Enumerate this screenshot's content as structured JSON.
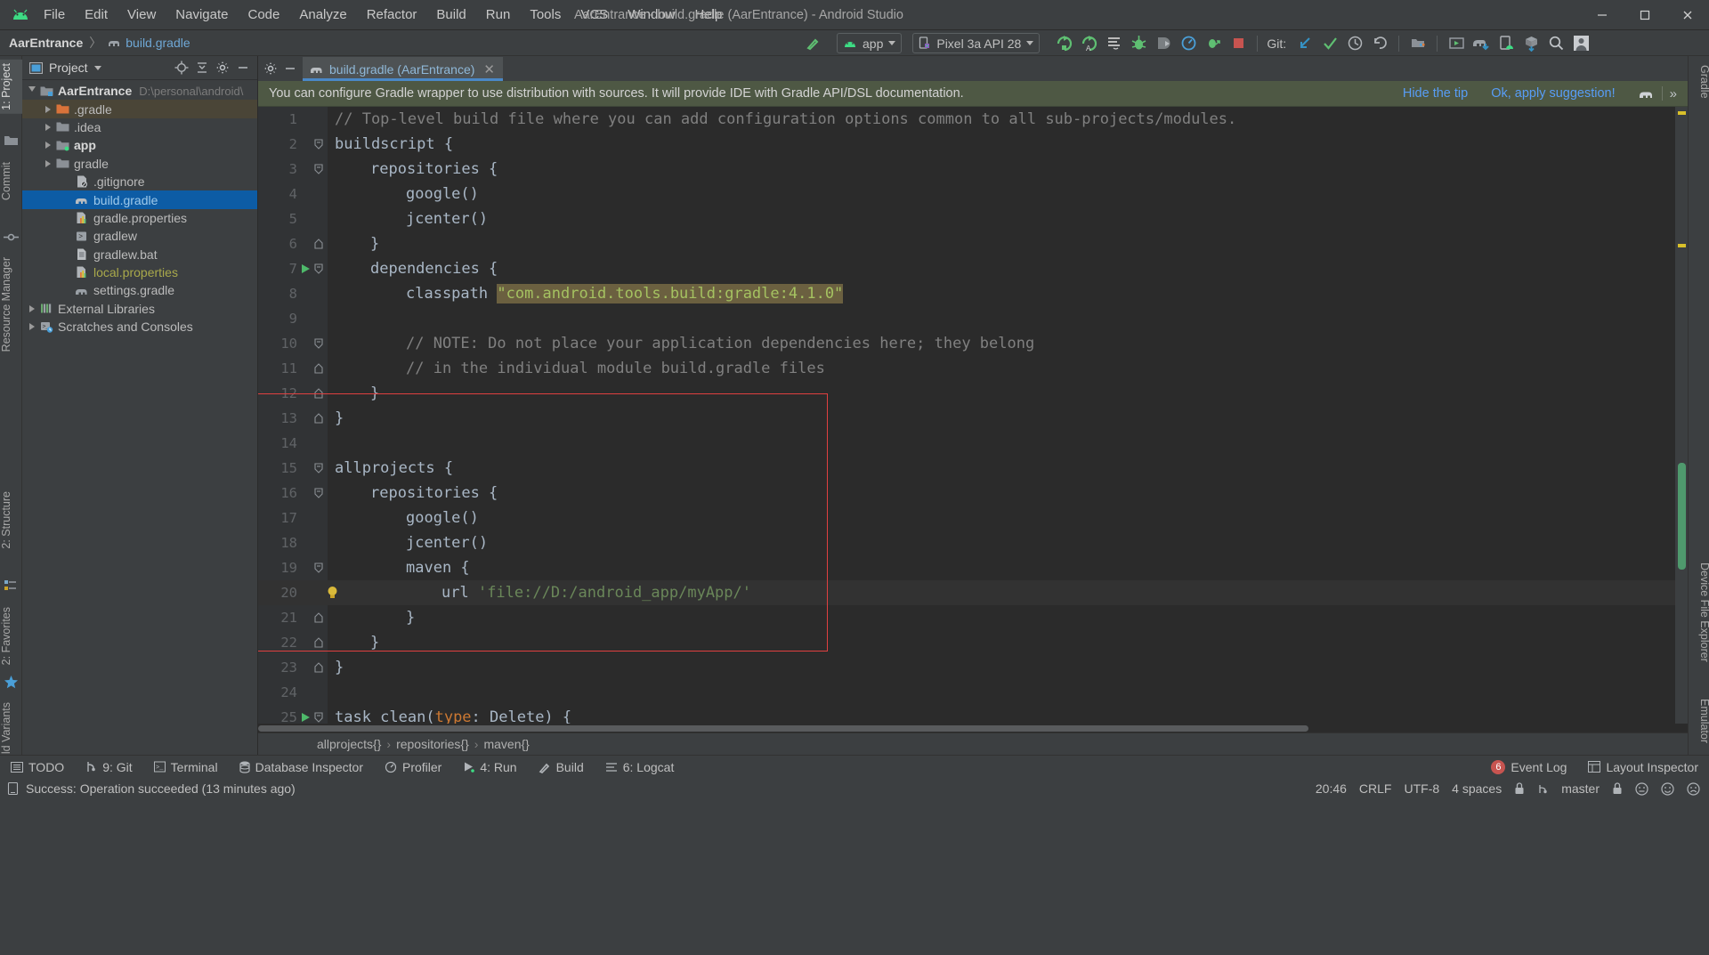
{
  "window": {
    "title": "AarEntrance - build.gradle (AarEntrance) - Android Studio",
    "minimize_label": "–",
    "maximize_label": "❐",
    "close_label": "✕"
  },
  "menu": [
    {
      "label": "File",
      "mnemonic": "F"
    },
    {
      "label": "Edit",
      "mnemonic": "E"
    },
    {
      "label": "View",
      "mnemonic": "V"
    },
    {
      "label": "Navigate",
      "mnemonic": "N"
    },
    {
      "label": "Code",
      "mnemonic": "C"
    },
    {
      "label": "Analyze",
      "mnemonic": "z"
    },
    {
      "label": "Refactor",
      "mnemonic": "R"
    },
    {
      "label": "Build",
      "mnemonic": "B"
    },
    {
      "label": "Run",
      "mnemonic": "u"
    },
    {
      "label": "Tools",
      "mnemonic": "T"
    },
    {
      "label": "VCS",
      "mnemonic": "S"
    },
    {
      "label": "Window",
      "mnemonic": "W"
    },
    {
      "label": "Help",
      "mnemonic": "H"
    }
  ],
  "navbar": {
    "project_crumb": "AarEntrance",
    "separator": "〉",
    "file_crumb": "build.gradle",
    "run_config": "app",
    "device": "Pixel 3a API 28",
    "git_label": "Git:"
  },
  "toolbar_icons": [
    {
      "name": "build-hammer-icon"
    },
    {
      "name": "run-icon"
    },
    {
      "name": "run-with-coverage-icon"
    },
    {
      "name": "apply-changes-icon"
    },
    {
      "name": "debug-icon"
    },
    {
      "name": "attach-debugger-icon"
    },
    {
      "name": "profiler-icon"
    },
    {
      "name": "debug-attach-icon"
    },
    {
      "name": "stop-icon"
    },
    {
      "name": "git-update-icon"
    },
    {
      "name": "git-commit-icon"
    },
    {
      "name": "git-history-icon"
    },
    {
      "name": "git-rollback-icon"
    },
    {
      "name": "sdk-manager-icon"
    },
    {
      "name": "avd-manager-icon"
    },
    {
      "name": "sync-gradle-icon"
    },
    {
      "name": "layout-inspector-icon"
    },
    {
      "name": "device-manager-icon"
    },
    {
      "name": "search-everywhere-icon"
    },
    {
      "name": "user-avatar-icon"
    }
  ],
  "left_strip": [
    {
      "label": "1: Project",
      "name": "tool-tab-project",
      "selected": true
    },
    {
      "label": "Commit",
      "name": "tool-tab-commit",
      "selected": false
    },
    {
      "label": "Resource Manager",
      "name": "tool-tab-resource-manager",
      "selected": false
    },
    {
      "label": "2: Structure",
      "name": "tool-tab-structure",
      "selected": false
    },
    {
      "label": "2: Favorites",
      "name": "tool-tab-favorites",
      "selected": false
    },
    {
      "label": "Build Variants",
      "name": "tool-tab-build-variants",
      "selected": false
    }
  ],
  "right_strip": [
    {
      "label": "Gradle",
      "name": "tool-tab-gradle"
    },
    {
      "label": "Device File Explorer",
      "name": "tool-tab-device-file-explorer"
    },
    {
      "label": "Emulator",
      "name": "tool-tab-emulator"
    }
  ],
  "project_panel": {
    "title": "Project",
    "actions": [
      "locate-icon",
      "collapse-all-icon",
      "settings-gear-icon",
      "hide-icon"
    ],
    "tree": [
      {
        "label": "AarEntrance",
        "path": "D:\\personal\\android\\",
        "indent": 0,
        "arrow": "open",
        "icon": "module-folder-icon",
        "style": "bold",
        "selected": false
      },
      {
        "label": ".gradle",
        "path": "",
        "indent": 1,
        "arrow": "closed",
        "icon": "orange-folder-icon",
        "style": "normal",
        "selected": "grey"
      },
      {
        "label": ".idea",
        "path": "",
        "indent": 1,
        "arrow": "closed",
        "icon": "folder-icon",
        "style": "normal",
        "selected": false
      },
      {
        "label": "app",
        "path": "",
        "indent": 1,
        "arrow": "closed",
        "icon": "module-folder-icon",
        "style": "bold",
        "selected": false
      },
      {
        "label": "gradle",
        "path": "",
        "indent": 1,
        "arrow": "closed",
        "icon": "folder-icon",
        "style": "normal",
        "selected": false
      },
      {
        "label": ".gitignore",
        "path": "",
        "indent": 2,
        "arrow": "none",
        "icon": "gitignore-file-icon",
        "style": "normal",
        "selected": false
      },
      {
        "label": "build.gradle",
        "path": "",
        "indent": 2,
        "arrow": "none",
        "icon": "gradle-file-icon",
        "style": "blue",
        "selected": true
      },
      {
        "label": "gradle.properties",
        "path": "",
        "indent": 2,
        "arrow": "none",
        "icon": "properties-file-icon",
        "style": "normal",
        "selected": false
      },
      {
        "label": "gradlew",
        "path": "",
        "indent": 2,
        "arrow": "none",
        "icon": "script-file-icon",
        "style": "normal",
        "selected": false
      },
      {
        "label": "gradlew.bat",
        "path": "",
        "indent": 2,
        "arrow": "none",
        "icon": "bat-file-icon",
        "style": "normal",
        "selected": false
      },
      {
        "label": "local.properties",
        "path": "",
        "indent": 2,
        "arrow": "none",
        "icon": "properties-file-icon",
        "style": "olive",
        "selected": false
      },
      {
        "label": "settings.gradle",
        "path": "",
        "indent": 2,
        "arrow": "none",
        "icon": "gradle-file-icon",
        "style": "normal",
        "selected": false
      },
      {
        "label": "External Libraries",
        "path": "",
        "indent": 0,
        "arrow": "closed",
        "icon": "libraries-icon",
        "style": "normal",
        "selected": false
      },
      {
        "label": "Scratches and Consoles",
        "path": "",
        "indent": 0,
        "arrow": "closed",
        "icon": "scratches-icon",
        "style": "normal",
        "selected": false
      }
    ]
  },
  "editor": {
    "tab_label": "build.gradle (AarEntrance)",
    "tab_close": "✕",
    "notification": {
      "message": "You can configure Gradle wrapper to use distribution with sources. It will provide IDE with Gradle API/DSL documentation.",
      "hide_link": "Hide the tip",
      "apply_link": "Ok, apply suggestion!"
    },
    "lines": [
      {
        "num": 1,
        "indent": 0,
        "tokens": [
          {
            "t": "// Top-level build file where you can add configuration options common to all sub-projects/modules.",
            "c": "comment"
          }
        ],
        "fold": "none",
        "run": false,
        "bulb": false,
        "hl": false
      },
      {
        "num": 2,
        "indent": 0,
        "tokens": [
          {
            "t": "buildscript {",
            "c": "default"
          }
        ],
        "fold": "open",
        "run": false,
        "bulb": false,
        "hl": false
      },
      {
        "num": 3,
        "indent": 1,
        "tokens": [
          {
            "t": "repositories {",
            "c": "default"
          }
        ],
        "fold": "open",
        "run": false,
        "bulb": false,
        "hl": false
      },
      {
        "num": 4,
        "indent": 2,
        "tokens": [
          {
            "t": "google()",
            "c": "default"
          }
        ],
        "fold": "none",
        "run": false,
        "bulb": false,
        "hl": false
      },
      {
        "num": 5,
        "indent": 2,
        "tokens": [
          {
            "t": "jcenter()",
            "c": "default"
          }
        ],
        "fold": "none",
        "run": false,
        "bulb": false,
        "hl": false
      },
      {
        "num": 6,
        "indent": 1,
        "tokens": [
          {
            "t": "}",
            "c": "default"
          }
        ],
        "fold": "close",
        "run": false,
        "bulb": false,
        "hl": false
      },
      {
        "num": 7,
        "indent": 1,
        "tokens": [
          {
            "t": "dependencies {",
            "c": "default"
          }
        ],
        "fold": "open",
        "run": true,
        "bulb": false,
        "hl": false
      },
      {
        "num": 8,
        "indent": 2,
        "tokens": [
          {
            "t": "classpath ",
            "c": "default"
          },
          {
            "t": "\"com.android.tools.build:gradle:4.1.0\"",
            "c": "str-hl"
          }
        ],
        "fold": "none",
        "run": false,
        "bulb": false,
        "hl": false
      },
      {
        "num": 9,
        "indent": 0,
        "tokens": [],
        "fold": "none",
        "run": false,
        "bulb": false,
        "hl": false
      },
      {
        "num": 10,
        "indent": 2,
        "tokens": [
          {
            "t": "// NOTE: Do not place your application dependencies here; they belong",
            "c": "comment"
          }
        ],
        "fold": "open",
        "run": false,
        "bulb": false,
        "hl": false
      },
      {
        "num": 11,
        "indent": 2,
        "tokens": [
          {
            "t": "// in the individual module build.gradle files",
            "c": "comment"
          }
        ],
        "fold": "close",
        "run": false,
        "bulb": false,
        "hl": false
      },
      {
        "num": 12,
        "indent": 1,
        "tokens": [
          {
            "t": "}",
            "c": "default"
          }
        ],
        "fold": "close",
        "run": false,
        "bulb": false,
        "hl": false
      },
      {
        "num": 13,
        "indent": 0,
        "tokens": [
          {
            "t": "}",
            "c": "default"
          }
        ],
        "fold": "close",
        "run": false,
        "bulb": false,
        "hl": false
      },
      {
        "num": 14,
        "indent": 0,
        "tokens": [],
        "fold": "none",
        "run": false,
        "bulb": false,
        "hl": false
      },
      {
        "num": 15,
        "indent": 0,
        "tokens": [
          {
            "t": "allprojects {",
            "c": "default"
          }
        ],
        "fold": "open",
        "run": false,
        "bulb": false,
        "hl": false
      },
      {
        "num": 16,
        "indent": 1,
        "tokens": [
          {
            "t": "repositories {",
            "c": "default"
          }
        ],
        "fold": "open",
        "run": false,
        "bulb": false,
        "hl": false
      },
      {
        "num": 17,
        "indent": 2,
        "tokens": [
          {
            "t": "google()",
            "c": "default"
          }
        ],
        "fold": "none",
        "run": false,
        "bulb": false,
        "hl": false
      },
      {
        "num": 18,
        "indent": 2,
        "tokens": [
          {
            "t": "jcenter()",
            "c": "default"
          }
        ],
        "fold": "none",
        "run": false,
        "bulb": false,
        "hl": false
      },
      {
        "num": 19,
        "indent": 2,
        "tokens": [
          {
            "t": "maven {",
            "c": "default"
          }
        ],
        "fold": "open",
        "run": false,
        "bulb": false,
        "hl": false
      },
      {
        "num": 20,
        "indent": 3,
        "tokens": [
          {
            "t": "url ",
            "c": "default"
          },
          {
            "t": "'file://D:/android_app/myApp/'",
            "c": "str"
          }
        ],
        "fold": "none",
        "run": false,
        "bulb": true,
        "hl": true
      },
      {
        "num": 21,
        "indent": 2,
        "tokens": [
          {
            "t": "}",
            "c": "default"
          }
        ],
        "fold": "close",
        "run": false,
        "bulb": false,
        "hl": false
      },
      {
        "num": 22,
        "indent": 1,
        "tokens": [
          {
            "t": "}",
            "c": "default"
          }
        ],
        "fold": "close",
        "run": false,
        "bulb": false,
        "hl": false
      },
      {
        "num": 23,
        "indent": 0,
        "tokens": [
          {
            "t": "}",
            "c": "default"
          }
        ],
        "fold": "close",
        "run": false,
        "bulb": false,
        "hl": false
      },
      {
        "num": 24,
        "indent": 0,
        "tokens": [],
        "fold": "none",
        "run": false,
        "bulb": false,
        "hl": false
      },
      {
        "num": 25,
        "indent": 0,
        "tokens": [
          {
            "t": "task clean(",
            "c": "default"
          },
          {
            "t": "type",
            "c": "kw"
          },
          {
            "t": ": Delete) {",
            "c": "default"
          }
        ],
        "fold": "open",
        "run": true,
        "bulb": false,
        "hl": false
      }
    ],
    "breadcrumbs": [
      "allprojects{}",
      "repositories{}",
      "maven{}"
    ],
    "breadcrumb_sep": "›"
  },
  "tool_window_bar": {
    "left_items": [
      {
        "label": "TODO",
        "icon": "todo-icon"
      },
      {
        "label": "9: Git",
        "icon": "git-icon"
      },
      {
        "label": "Terminal",
        "icon": "terminal-icon"
      },
      {
        "label": "Database Inspector",
        "icon": "database-icon"
      },
      {
        "label": "Profiler",
        "icon": "profiler-icon"
      },
      {
        "label": "4: Run",
        "icon": "run-icon"
      },
      {
        "label": "Build",
        "icon": "build-hammer-icon"
      },
      {
        "label": "6: Logcat",
        "icon": "logcat-icon"
      }
    ],
    "right_items": [
      {
        "label": "Event Log",
        "icon": "event-log-icon",
        "badge": "6"
      },
      {
        "label": "Layout Inspector",
        "icon": "layout-inspector-icon",
        "badge": ""
      }
    ]
  },
  "statusbar": {
    "message": "Success: Operation succeeded (13 minutes ago)",
    "time": "20:46",
    "line_sep": "CRLF",
    "encoding": "UTF-8",
    "indent": "4 spaces",
    "branch": "master",
    "lock_icon": "lock-icon",
    "emoji_icons": [
      "neutral-face-icon",
      "smiley-face-icon",
      "sad-face-icon"
    ]
  },
  "colors": {
    "accent_blue": "#4a88c7",
    "selection_blue": "#0d5ca5",
    "notif_green": "#4e5844",
    "red_box": "#e04040",
    "error_red": "#c75450",
    "android_green": "#3ddc84"
  }
}
